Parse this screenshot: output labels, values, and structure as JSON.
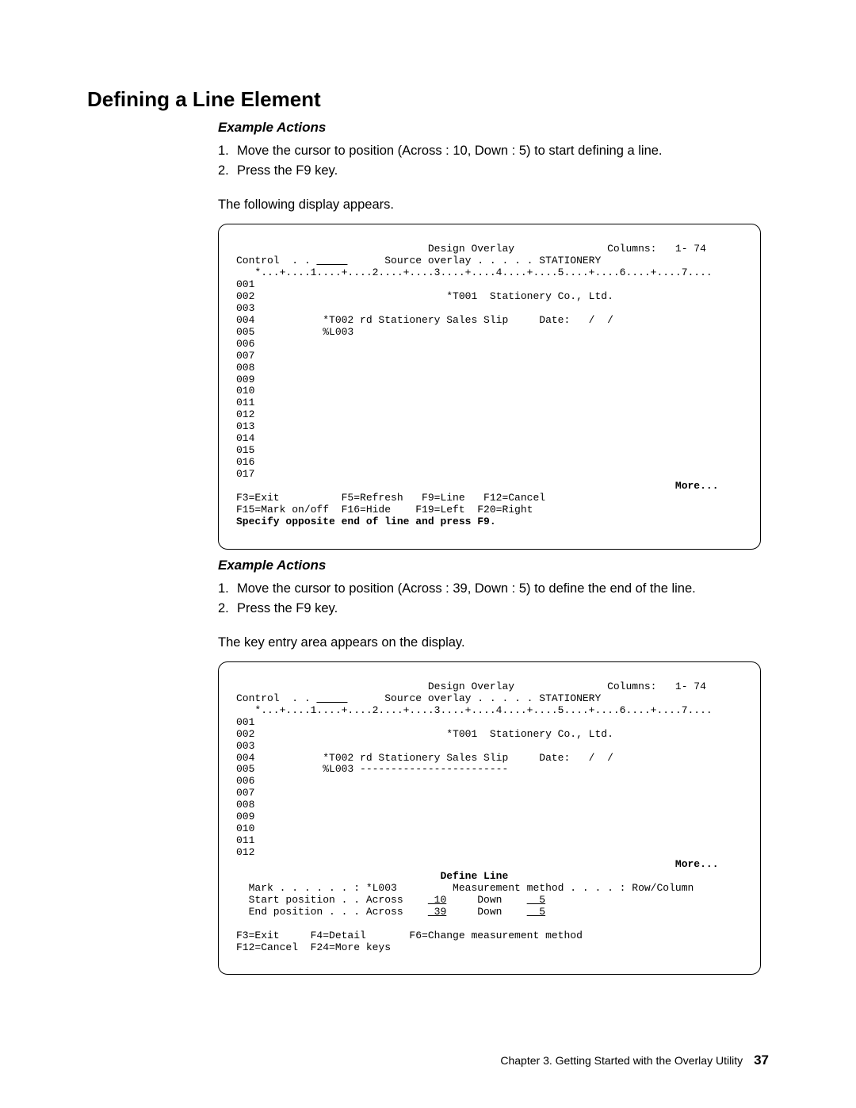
{
  "heading": "Defining a Line Element",
  "ex1_title": "Example Actions",
  "ex1_item1_num": "1.",
  "ex1_item1_text": "Move the cursor to position (Across : 10, Down : 5) to start defining a line.",
  "ex1_item2_num": "2.",
  "ex1_item2_text": "Press the F9 key.",
  "para1": "The following display appears.",
  "term1": {
    "title_line": "                               Design Overlay               Columns:   1- 74",
    "control_pre": "Control  . . ",
    "control_post": "      Source overlay . . . . . STATIONERY",
    "ruler": "   *...+....1....+....2....+....3....+....4....+....5....+....6....+....7....",
    "l001": "001",
    "l002": "002                               *T001  Stationery Co., Ltd.",
    "l003": "003",
    "l004": "004           *T002 rd Stationery Sales Slip     Date:   /  /",
    "l005": "005           %L003",
    "l006": "006",
    "l007": "007",
    "l008": "008",
    "l009": "009",
    "l010": "010",
    "l011": "011",
    "l012": "012",
    "l013": "013",
    "l014": "014",
    "l015": "015",
    "l016": "016",
    "l017": "017",
    "more_line": "                                                                       More...",
    "fkeys1": "F3=Exit          F5=Refresh   F9=Line   F12=Cancel",
    "fkeys2": "F15=Mark on/off  F16=Hide    F19=Left  F20=Right",
    "prompt": "Specify opposite end of line and press F9."
  },
  "ex2_title": "Example Actions",
  "ex2_item1_num": "1.",
  "ex2_item1_text": "Move the cursor to position (Across : 39, Down : 5) to define the end of the line.",
  "ex2_item2_num": "2.",
  "ex2_item2_text": "Press the F9 key.",
  "para2": "The key entry area appears on the display.",
  "term2": {
    "title_line": "                               Design Overlay               Columns:   1- 74",
    "control_pre": "Control  . . ",
    "control_post": "      Source overlay . . . . . STATIONERY",
    "ruler": "   *...+....1....+....2....+....3....+....4....+....5....+....6....+....7....",
    "l001": "001",
    "l002": "002                               *T001  Stationery Co., Ltd.",
    "l003": "003",
    "l004": "004           *T002 rd Stationery Sales Slip     Date:   /  /",
    "l005": "005           %L003 ------------------------",
    "l006": "006",
    "l007": "007",
    "l008": "008",
    "l009": "009",
    "l010": "010",
    "l011": "011",
    "l012": "012",
    "more_line": "                                                                       More...",
    "define_title": "                                 Define Line",
    "mark_line": "  Mark . . . . . . : *L003         Measurement method . . . . : Row/Column",
    "start_pre": "  Start position . . Across    ",
    "start_val1": " 10",
    "start_mid": "     Down    ",
    "start_val2": "  5",
    "end_pre": "  End position . . . Across    ",
    "end_val1": " 39",
    "end_mid": "     Down    ",
    "end_val2": "  5",
    "fkeys1": "F3=Exit     F4=Detail       F6=Change measurement method",
    "fkeys2": "F12=Cancel  F24=More keys"
  },
  "footer_text": "Chapter 3. Getting Started with the Overlay Utility",
  "footer_page": "37"
}
